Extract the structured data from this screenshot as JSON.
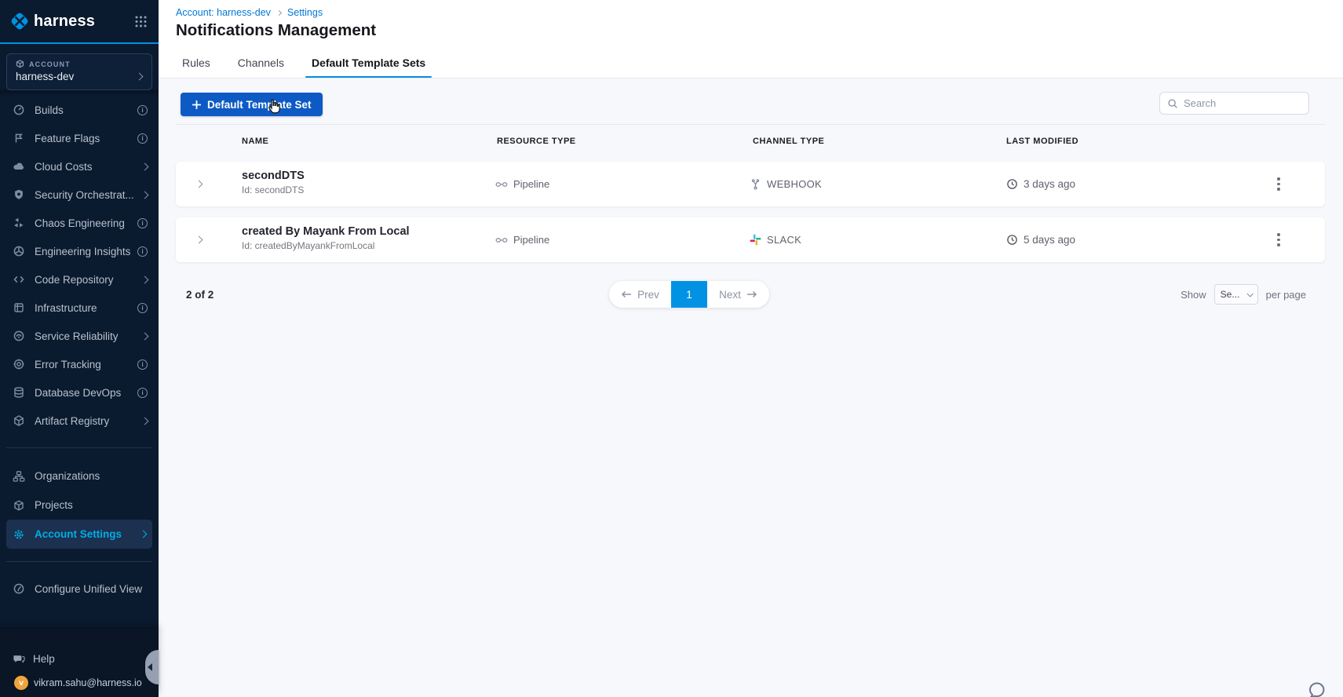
{
  "sidebar": {
    "logo_text": "harness",
    "account": {
      "label": "ACCOUNT",
      "name": "harness-dev"
    },
    "nav": [
      {
        "label": "Builds",
        "trailing": "info"
      },
      {
        "label": "Feature Flags",
        "trailing": "info"
      },
      {
        "label": "Cloud Costs",
        "trailing": "chevron"
      },
      {
        "label": "Security Orchestrat...",
        "trailing": "chevron"
      },
      {
        "label": "Chaos Engineering",
        "trailing": "info"
      },
      {
        "label": "Engineering Insights",
        "trailing": "info"
      },
      {
        "label": "Code Repository",
        "trailing": "chevron"
      },
      {
        "label": "Infrastructure",
        "trailing": "info"
      },
      {
        "label": "Service Reliability",
        "trailing": "chevron"
      },
      {
        "label": "Error Tracking",
        "trailing": "info"
      },
      {
        "label": "Database DevOps",
        "trailing": "info"
      },
      {
        "label": "Artifact Registry",
        "trailing": "chevron"
      }
    ],
    "secondary": [
      {
        "label": "Organizations"
      },
      {
        "label": "Projects"
      },
      {
        "label": "Account Settings"
      }
    ],
    "configure_label": "Configure Unified View",
    "help_label": "Help",
    "user_email": "vikram.sahu@harness.io",
    "user_initial": "v"
  },
  "header": {
    "breadcrumbs": [
      "Account: harness-dev",
      "Settings"
    ],
    "title": "Notifications Management",
    "tabs": [
      {
        "label": "Rules"
      },
      {
        "label": "Channels"
      },
      {
        "label": "Default Template Sets"
      }
    ]
  },
  "toolbar": {
    "new_button_label": "Default Template Set",
    "search_placeholder": "Search"
  },
  "table": {
    "columns": [
      "NAME",
      "RESOURCE TYPE",
      "CHANNEL TYPE",
      "LAST MODIFIED"
    ],
    "rows": [
      {
        "name": "secondDTS",
        "id_line": "Id: secondDTS",
        "resource_type": "Pipeline",
        "channel_type": "WEBHOOK",
        "last_modified": "3 days ago"
      },
      {
        "name": "created By Mayank From Local",
        "id_line": "Id: createdByMayankFromLocal",
        "resource_type": "Pipeline",
        "channel_type": "SLACK",
        "last_modified": "5 days ago"
      }
    ]
  },
  "pagination": {
    "summary": "2 of 2",
    "prev_label": "Prev",
    "current_page": "1",
    "next_label": "Next",
    "show_label": "Show",
    "page_size_value": "Se...",
    "per_page_label": "per page"
  },
  "colors": {
    "sidebar_bg": "#0a1b30",
    "accent_blue": "#0092e4",
    "link_blue": "#0278d5",
    "button_blue": "#0d5ac4",
    "active_nav_text": "#00ade4",
    "avatar_orange": "#f0a53c",
    "slack_blue": "#36c5f0",
    "slack_green": "#2eb67d",
    "slack_yellow": "#ecb22e",
    "slack_red": "#e01e5a"
  }
}
